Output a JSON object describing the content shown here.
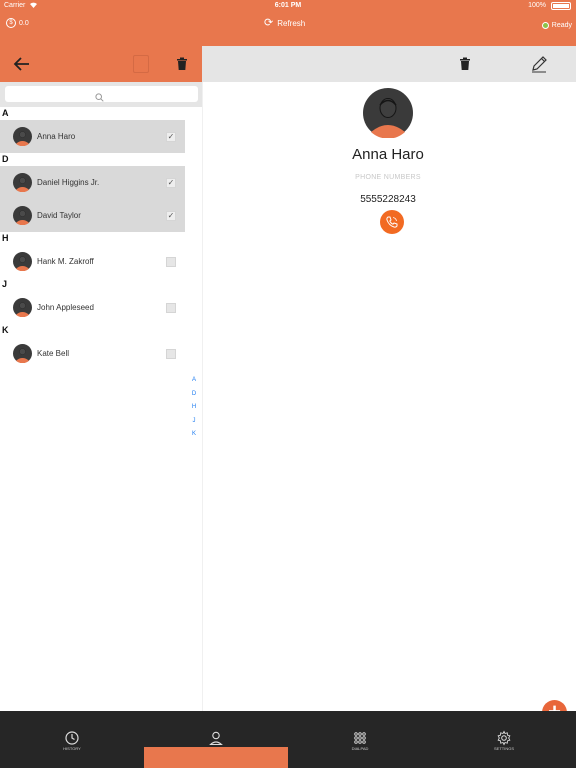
{
  "status_bar": {
    "carrier": "Carrier",
    "time": "6:01 PM",
    "battery": "100%"
  },
  "header": {
    "balance": "0.0",
    "refresh_label": "Refresh",
    "status": "Ready"
  },
  "search": {
    "placeholder": ""
  },
  "contacts": {
    "sections": [
      {
        "letter": "A",
        "items": [
          {
            "name": "Anna Haro",
            "selected": true
          }
        ]
      },
      {
        "letter": "D",
        "items": [
          {
            "name": "Daniel Higgins Jr.",
            "selected": true
          },
          {
            "name": "David Taylor",
            "selected": true
          }
        ]
      },
      {
        "letter": "H",
        "items": [
          {
            "name": "Hank M. Zakroff",
            "selected": false
          }
        ]
      },
      {
        "letter": "J",
        "items": [
          {
            "name": "John Appleseed",
            "selected": false
          }
        ]
      },
      {
        "letter": "K",
        "items": [
          {
            "name": "Kate Bell",
            "selected": false
          }
        ]
      }
    ],
    "index": [
      "A",
      "D",
      "H",
      "J",
      "K"
    ]
  },
  "detail": {
    "name": "Anna Haro",
    "phone_label": "PHONE NUMBERS",
    "phone": "5555228243"
  },
  "tabs": [
    {
      "label": "HISTORY",
      "icon": "clock-icon"
    },
    {
      "label": "",
      "icon": "contacts-person-icon"
    },
    {
      "label": "DIALPAD",
      "icon": "dialpad-icon"
    },
    {
      "label": "SETTINGS",
      "icon": "gear-icon"
    }
  ],
  "colors": {
    "accent": "#e8774d",
    "call": "#f26a22",
    "tabbar": "#262626",
    "index_link": "#1e7cf0",
    "ready_dot": "#8bc34a"
  }
}
